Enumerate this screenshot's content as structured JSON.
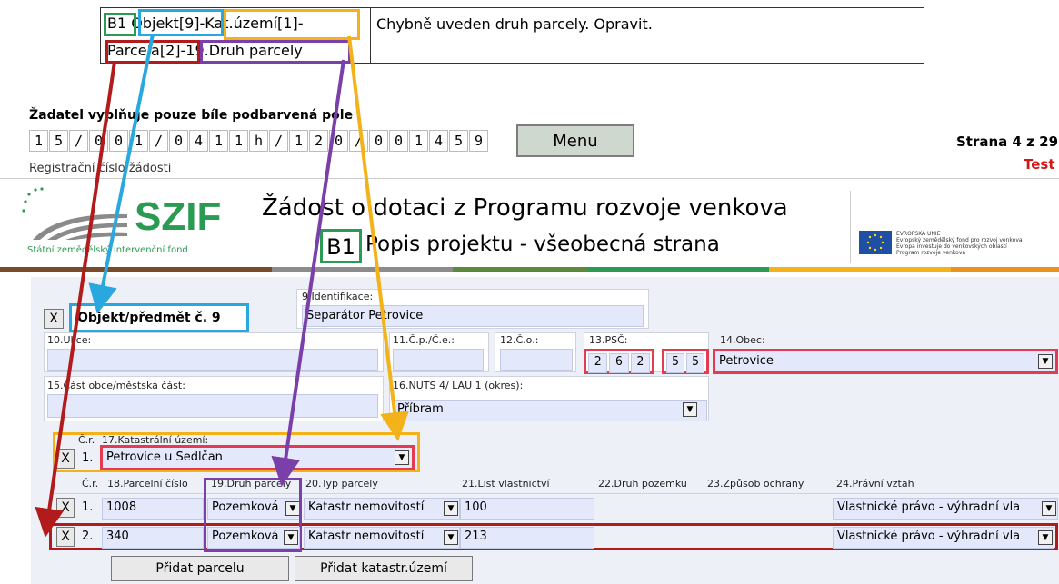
{
  "error_note": {
    "path_line1": "B1 Objekt[9]-Kat.území[1]-",
    "path_line2": "Parcela[2]-19.Druh parcely",
    "message": "Chybně uveden druh parcely. Opravit."
  },
  "header": {
    "instruction": "Žadatel vyplňuje pouze bíle podbarvená pole",
    "reg_digits": [
      "1",
      "5",
      "/",
      "0",
      "0",
      "1",
      "/",
      "0",
      "4",
      "1",
      "1",
      "h",
      "/",
      "1",
      "2",
      "0",
      "/",
      "0",
      "0",
      "1",
      "4",
      "5",
      "9"
    ],
    "reg_label": "Registrační číslo žádosti",
    "menu_label": "Menu",
    "page_info": "Strana 4 z 29",
    "test_label": "Test"
  },
  "banner": {
    "logo_text": "SZIF",
    "logo_subtitle": "Státní zemědělský intervenční fond",
    "title": "Žádost o dotaci z Programu rozvoje venkova",
    "section_code": "B1",
    "section_title": "Popis projektu - všeobecná strana",
    "eu_line1": "EVROPSKÁ UNIE",
    "eu_line2": "Evropský zemědělský fond pro rozvoj venkova",
    "eu_line3": "Evropa investuje do venkovských oblastí",
    "eu_line4": "Program rozvoje venkova"
  },
  "colors": {
    "accent_green": "#2b9b54",
    "blue": "#29a8df",
    "yellow": "#f3b21a",
    "purple": "#7a3fa8",
    "darkred": "#b11b1b",
    "pink": "#e23b52"
  },
  "form": {
    "remove_label": "X",
    "object_title": "Objekt/předmět č. 9",
    "identification_label": "9.Identifikace:",
    "identification_value": "Separátor Petrovice",
    "street_label": "10.Ulice:",
    "cp_label": "11.Č.p./Č.e.:",
    "co_label": "12.Č.o.:",
    "psc_label": "13.PSČ:",
    "psc_digits": [
      "2",
      "6",
      "2",
      "5",
      "5"
    ],
    "obec_label": "14.Obec:",
    "obec_value": "Petrovice",
    "district_label": "15.Část obce/městská část:",
    "nuts_label": "16.NUTS 4/ LAU 1 (okres):",
    "nuts_value": "Příbram",
    "cr_label": "Č.r.",
    "kat_label": "17.Katastrální území:",
    "kat_row_num": "1.",
    "kat_value": "Petrovice u Sedlčan"
  },
  "parcel_table": {
    "headers": [
      "Č.r.",
      "18.Parcelní číslo",
      "19.Druh parcely",
      "20.Typ parcely",
      "21.List vlastnictví",
      "22.Druh pozemku",
      "23.Způsob ochrany",
      "24.Právní vztah"
    ],
    "rows": [
      {
        "num": "1.",
        "parcel": "1008",
        "druh": "Pozemková",
        "typ": "Katastr nemovitostí",
        "lv": "100",
        "pravni": "Vlastnické právo - výhradní vla"
      },
      {
        "num": "2.",
        "parcel": "340",
        "druh": "Pozemková",
        "typ": "Katastr nemovitostí",
        "lv": "213",
        "pravni": "Vlastnické právo - výhradní vla"
      }
    ]
  },
  "buttons": {
    "add_parcel": "Přidat parcelu",
    "add_cadastre": "Přidat katastr.území"
  }
}
